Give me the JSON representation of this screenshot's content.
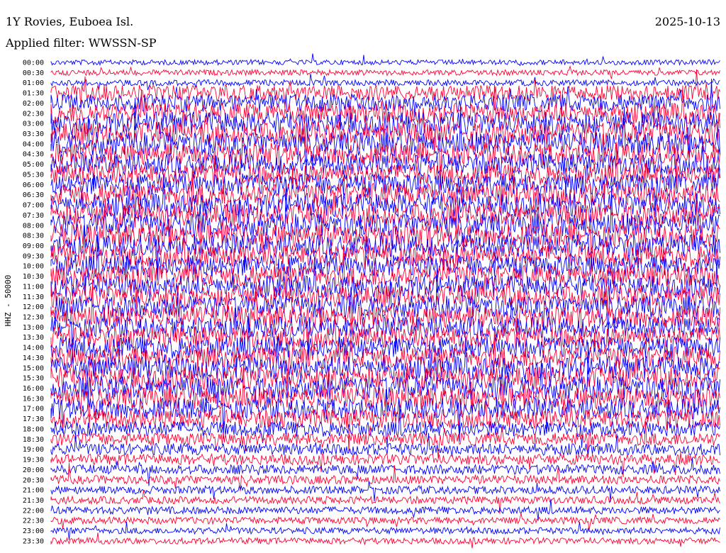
{
  "header": {
    "station": "1Y Rovies, Euboea Isl.",
    "filter": "Applied filter: WWSSN-SP",
    "date": "2025-10-13"
  },
  "chart_data": {
    "type": "line",
    "title": "1Y Rovies, Euboea Isl.",
    "subtitle": "Applied filter: WWSSN-SP",
    "ylabel": "HHZ - 50000",
    "colors": {
      "odd": "#0000ff",
      "even": "#ff0033"
    },
    "rows": [
      {
        "time": "00:00",
        "noise": 0.1
      },
      {
        "time": "00:30",
        "noise": 0.12
      },
      {
        "time": "01:00",
        "noise": 0.14
      },
      {
        "time": "01:30",
        "noise": 0.55
      },
      {
        "time": "02:00",
        "noise": 0.65
      },
      {
        "time": "02:30",
        "noise": 0.8
      },
      {
        "time": "03:00",
        "noise": 0.9
      },
      {
        "time": "03:30",
        "noise": 0.9
      },
      {
        "time": "04:00",
        "noise": 0.9
      },
      {
        "time": "04:30",
        "noise": 0.85
      },
      {
        "time": "05:00",
        "noise": 0.8
      },
      {
        "time": "05:30",
        "noise": 0.8
      },
      {
        "time": "06:00",
        "noise": 0.85
      },
      {
        "time": "06:30",
        "noise": 0.9
      },
      {
        "time": "07:00",
        "noise": 0.9
      },
      {
        "time": "07:30",
        "noise": 0.9
      },
      {
        "time": "08:00",
        "noise": 0.9
      },
      {
        "time": "08:30",
        "noise": 0.9
      },
      {
        "time": "09:00",
        "noise": 0.85
      },
      {
        "time": "09:30",
        "noise": 0.85
      },
      {
        "time": "10:00",
        "noise": 0.85
      },
      {
        "time": "10:30",
        "noise": 0.85
      },
      {
        "time": "11:00",
        "noise": 0.85
      },
      {
        "time": "11:30",
        "noise": 0.85
      },
      {
        "time": "12:00",
        "noise": 0.85
      },
      {
        "time": "12:30",
        "noise": 0.85
      },
      {
        "time": "13:00",
        "noise": 0.8
      },
      {
        "time": "13:30",
        "noise": 0.8
      },
      {
        "time": "14:00",
        "noise": 0.85
      },
      {
        "time": "14:30",
        "noise": 0.85
      },
      {
        "time": "15:00",
        "noise": 0.9
      },
      {
        "time": "15:30",
        "noise": 0.9
      },
      {
        "time": "16:00",
        "noise": 0.9
      },
      {
        "time": "16:30",
        "noise": 0.85
      },
      {
        "time": "17:00",
        "noise": 0.8
      },
      {
        "time": "17:30",
        "noise": 0.7
      },
      {
        "time": "18:00",
        "noise": 0.55
      },
      {
        "time": "18:30",
        "noise": 0.45
      },
      {
        "time": "19:00",
        "noise": 0.4
      },
      {
        "time": "19:30",
        "noise": 0.35
      },
      {
        "time": "20:00",
        "noise": 0.3
      },
      {
        "time": "20:30",
        "noise": 0.25
      },
      {
        "time": "21:00",
        "noise": 0.22
      },
      {
        "time": "21:30",
        "noise": 0.2
      },
      {
        "time": "22:00",
        "noise": 0.2
      },
      {
        "time": "22:30",
        "noise": 0.18
      },
      {
        "time": "23:00",
        "noise": 0.16
      },
      {
        "time": "23:30",
        "noise": 0.15
      }
    ]
  }
}
